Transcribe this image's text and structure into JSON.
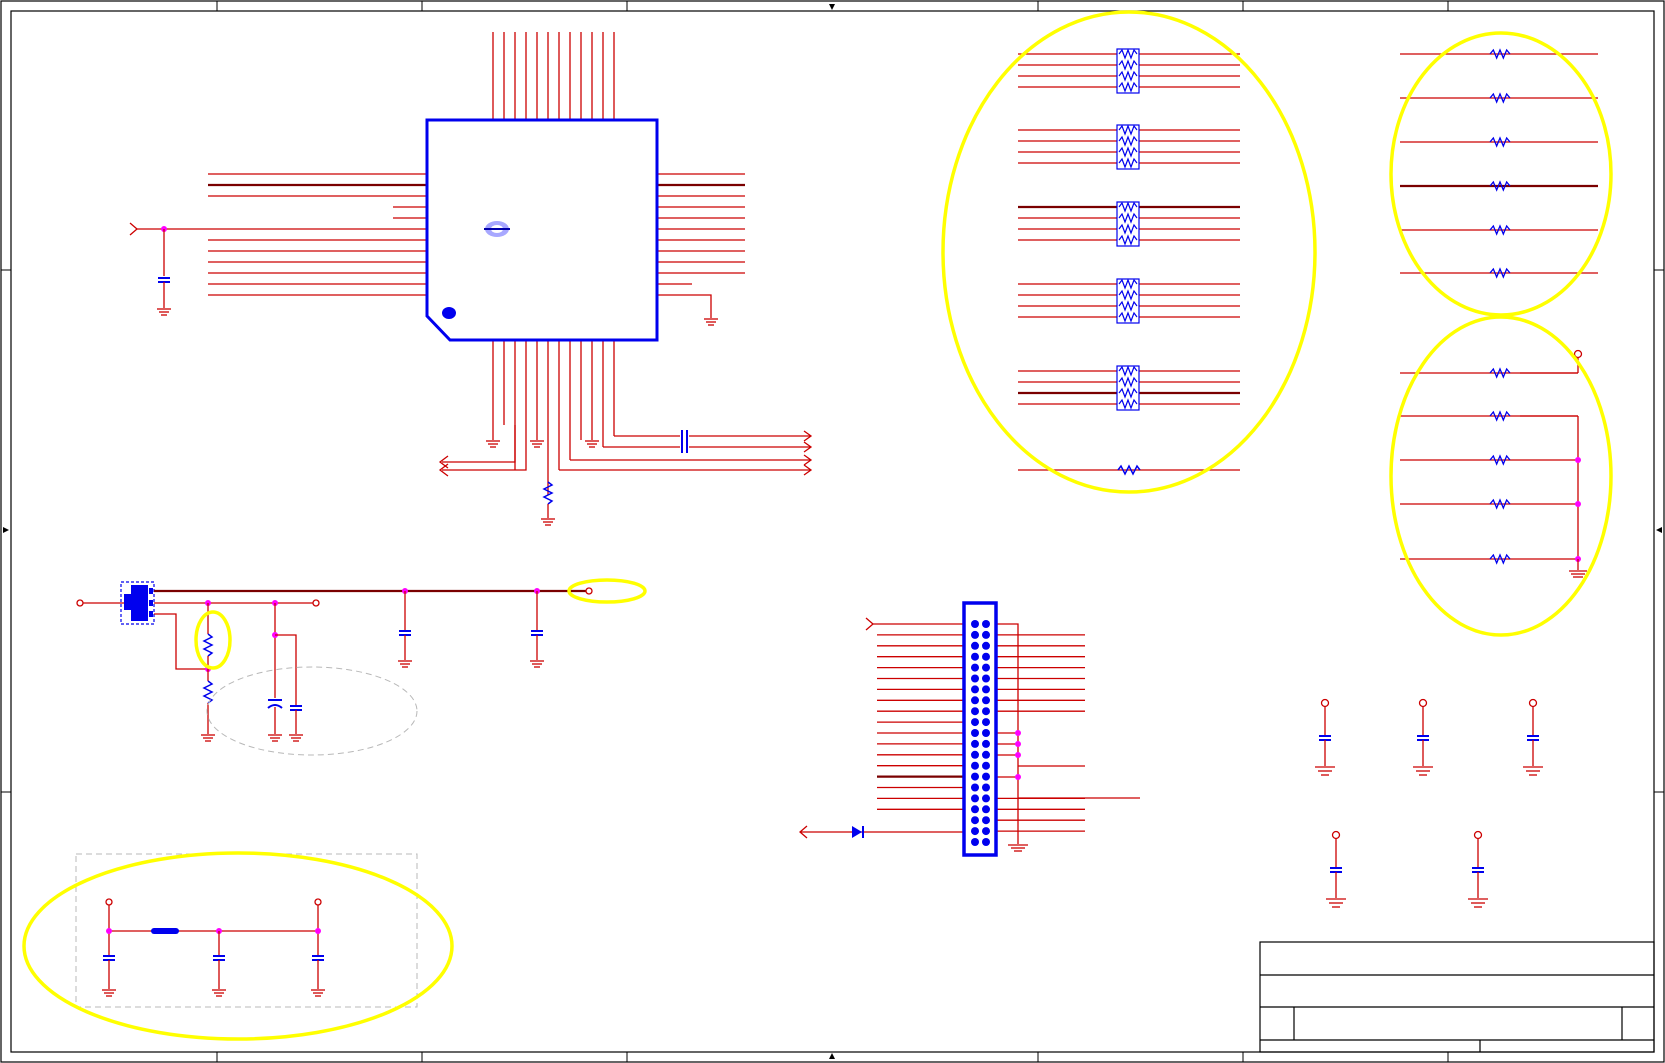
{
  "sheet": {
    "frame_color": "#000000",
    "wire_color": "#cc0000",
    "bus_color": "#7a0000",
    "component_color": "#0000ee",
    "junction_color": "#ff00ff",
    "highlight_color": "#ffff00"
  },
  "title_block": {
    "title": "",
    "document_number": "",
    "revision": "",
    "sheet_info": ""
  },
  "highlights": {
    "count": 7
  }
}
